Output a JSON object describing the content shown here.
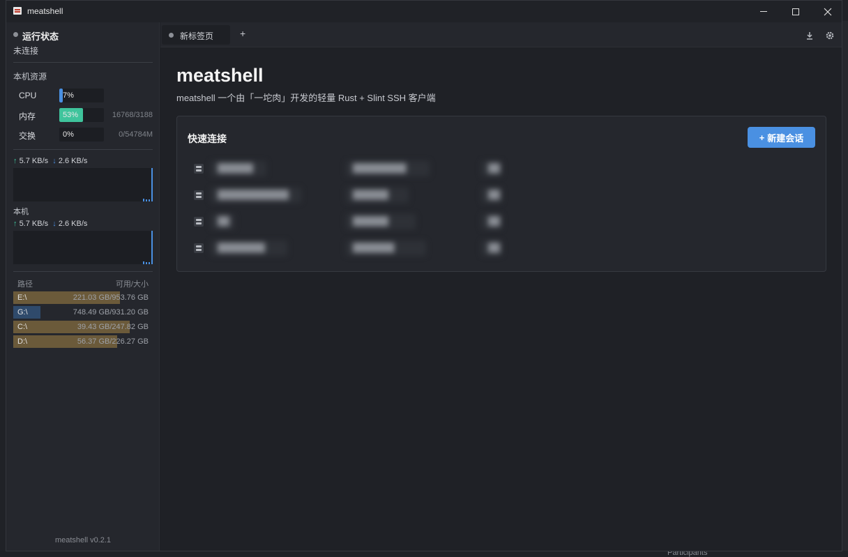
{
  "window": {
    "title": "meatshell"
  },
  "sidebar": {
    "status": {
      "title": "运行状态",
      "value": "未连接"
    },
    "resources": {
      "title": "本机资源",
      "items": [
        {
          "name": "CPU",
          "value": "7%",
          "percent": 7,
          "extra": "",
          "color": "#4a90e2"
        },
        {
          "name": "内存",
          "value": "53%",
          "percent": 53,
          "extra": "16768/3188",
          "color": "#3fc49c"
        },
        {
          "name": "交换",
          "value": "0%",
          "percent": 0,
          "extra": "0/54784M",
          "color": "#4a90e2"
        }
      ]
    },
    "network_total": {
      "up": "5.7 KB/s",
      "down": "2.6 KB/s"
    },
    "network_local": {
      "label": "本机",
      "up": "5.7 KB/s",
      "down": "2.6 KB/s"
    },
    "disks": {
      "header_path": "路径",
      "header_size": "可用/大小",
      "items": [
        {
          "name": "E:\\",
          "value": "221.03 GB/953.76 GB",
          "used_fraction": 0.79,
          "color": "#6b5a3a"
        },
        {
          "name": "G:\\",
          "value": "748.49 GB/931.20 GB",
          "used_fraction": 0.2,
          "color": "#2f4a6b"
        },
        {
          "name": "C:\\",
          "value": "39.43 GB/247.82 GB",
          "used_fraction": 0.86,
          "color": "#6b5a3a"
        },
        {
          "name": "D:\\",
          "value": "56.37 GB/226.27 GB",
          "used_fraction": 0.77,
          "color": "#6b5a3a"
        }
      ]
    },
    "version": "meatshell v0.2.1"
  },
  "tabs": [
    {
      "label": "新标签页"
    }
  ],
  "main": {
    "title": "meatshell",
    "description": "meatshell 一个由「一坨肉」开发的轻量 Rust + Slint SSH 客户端",
    "quick_connect": {
      "title": "快速连接",
      "new_session_label": "新建会话",
      "sessions": [
        {
          "name": "██████",
          "host": "█████████",
          "port": "██"
        },
        {
          "name": "████████████",
          "host": "██████",
          "port": "██"
        },
        {
          "name": "██",
          "host": "██████",
          "port": "██"
        },
        {
          "name": "████████",
          "host": "███████",
          "port": "██"
        }
      ]
    }
  },
  "desktop": {
    "bottom_text": "Participants"
  }
}
